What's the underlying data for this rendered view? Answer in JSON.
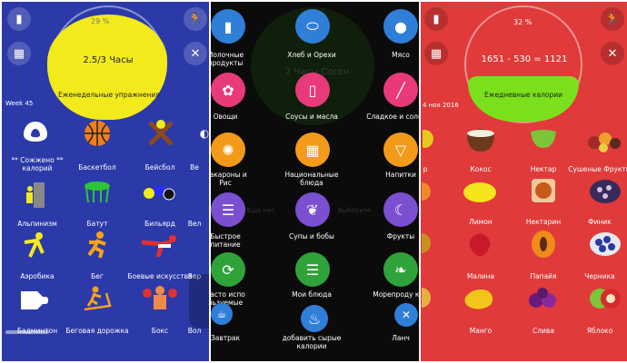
{
  "panel1": {
    "gauge_value": "2.5/3 Часы",
    "gauge_sub": "Еженедельные упражнения",
    "top_num": "29 %",
    "week": "Week 45",
    "items": [
      {
        "label": "** Сожжено ** калорий"
      },
      {
        "label": "Баскетбол"
      },
      {
        "label": "Бейсбол"
      },
      {
        "label": "Ве"
      },
      {
        "label": "Альпинизм"
      },
      {
        "label": "Батут"
      },
      {
        "label": "Бильярд"
      },
      {
        "label": "Вел"
      },
      {
        "label": "Аэробика"
      },
      {
        "label": "Бег"
      },
      {
        "label": "Боевые искусства"
      },
      {
        "label": "Вер"
      },
      {
        "label": "Бадминтон"
      },
      {
        "label": "Беговая дорожка"
      },
      {
        "label": "Бокс"
      },
      {
        "label": "Вол"
      }
    ]
  },
  "panel2": {
    "bg_text_1": "2 Часы",
    "bg_text_2": "Сосон",
    "bg_text_3": "Еще нет",
    "bg_text_4": "Выберите",
    "items": [
      {
        "label": "Молочные продукты"
      },
      {
        "label": "Хлеб и Орехи"
      },
      {
        "label": "Мясо"
      },
      {
        "label": "Овощи"
      },
      {
        "label": "Соусы и масла"
      },
      {
        "label": "Сладкое и соленое"
      },
      {
        "label": "Макароны и Рис"
      },
      {
        "label": "Национальные блюда"
      },
      {
        "label": "Напитки"
      },
      {
        "label": "Быстрое питание"
      },
      {
        "label": "Супы и бобы"
      },
      {
        "label": "Фрукты"
      },
      {
        "label": "Часто испо льзуемые"
      },
      {
        "label": "Мои блюда"
      },
      {
        "label": "Морепроду кты"
      },
      {
        "label": "Завтрак"
      },
      {
        "label": "добавить сырые калории"
      },
      {
        "label": "Ланч"
      }
    ]
  },
  "panel3": {
    "percent": "32 %",
    "equation": "1651 - 530 = 1121",
    "gauge_sub": "Ежедневные калории",
    "date": "4 ноя 2016",
    "items": [
      {
        "label": "р"
      },
      {
        "label": "Кокос"
      },
      {
        "label": "Нектар"
      },
      {
        "label": "Сушеные Фрукты"
      },
      {
        "label": ""
      },
      {
        "label": "Лимон"
      },
      {
        "label": "Нектарин"
      },
      {
        "label": "Финик"
      },
      {
        "label": ""
      },
      {
        "label": "Малина"
      },
      {
        "label": "Папайя"
      },
      {
        "label": "Черника"
      },
      {
        "label": ""
      },
      {
        "label": "Манго"
      },
      {
        "label": "Слива"
      },
      {
        "label": "Яблоко"
      }
    ]
  },
  "colors": {
    "blue_bg": "#2b3aa8",
    "red_bg": "#e03a3a",
    "dark_bg": "#0b0b0b",
    "yellow": "#f3ea1c",
    "green": "#7be01c"
  }
}
